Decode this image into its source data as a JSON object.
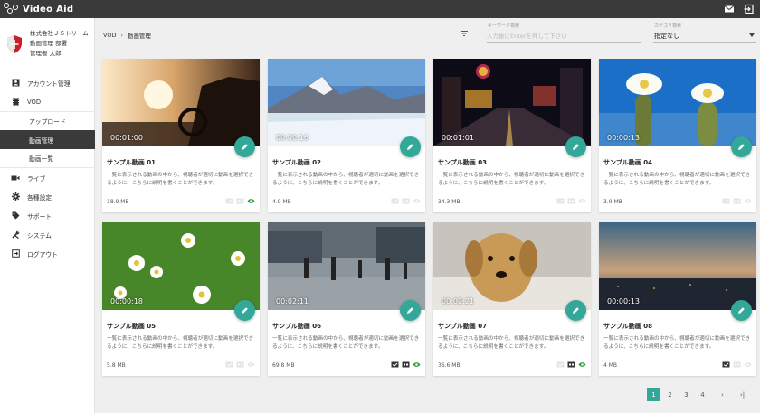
{
  "app": {
    "title": "Video Aid"
  },
  "org": {
    "company": "株式会社ＪＳトリーム",
    "department": "動画管理 部署",
    "user": "管理者 太郎"
  },
  "nav": {
    "items": [
      {
        "label": "アカウント管理",
        "icon": "user-card-icon"
      },
      {
        "label": "VOD",
        "icon": "film-icon"
      }
    ],
    "vod_sub": [
      {
        "label": "アップロード"
      },
      {
        "label": "動画管理"
      },
      {
        "label": "動画一覧"
      }
    ],
    "rest": [
      {
        "label": "ライブ",
        "icon": "video-camera-icon"
      },
      {
        "label": "各種設定",
        "icon": "gear-icon"
      },
      {
        "label": "サポート",
        "icon": "tag-icon"
      },
      {
        "label": "システム",
        "icon": "tools-icon"
      },
      {
        "label": "ログアウト",
        "icon": "logout-icon"
      }
    ]
  },
  "breadcrumb": {
    "root": "VOD",
    "current": "動画管理"
  },
  "search": {
    "label": "キーワード検索",
    "placeholder": "入力後にEnterを押して下さい",
    "value": ""
  },
  "category": {
    "label": "カテゴリ検索",
    "value": "指定なし"
  },
  "videos": [
    {
      "title": "サンプル動画 01",
      "duration": "00:01:00",
      "size": "18.9 MB",
      "desc": "一覧に表示される動画の中から、視聴者が適切に動画を選択できるように、こちらに説明を書くことができます。",
      "status": [
        "check-off",
        "cc-off",
        "eye-on"
      ]
    },
    {
      "title": "サンプル動画 02",
      "duration": "00:00:16",
      "size": "4.9 MB",
      "desc": "一覧に表示される動画の中から、視聴者が適切に動画を選択できるように、こちらに説明を書くことができます。",
      "status": [
        "check-off",
        "cc-off",
        "eye-off"
      ]
    },
    {
      "title": "サンプル動画 03",
      "duration": "00:01:01",
      "size": "34.3 MB",
      "desc": "一覧に表示される動画の中から、視聴者が適切に動画を選択できるように、こちらに説明を書くことができます。",
      "status": [
        "check-off",
        "cc-off",
        "eye-off"
      ]
    },
    {
      "title": "サンプル動画 04",
      "duration": "00:00:13",
      "size": "3.9 MB",
      "desc": "一覧に表示される動画の中から、視聴者が適切に動画を選択できるように、こちらに説明を書くことができます。",
      "status": [
        "check-off",
        "cc-off",
        "eye-off"
      ]
    },
    {
      "title": "サンプル動画 05",
      "duration": "00:00:18",
      "size": "5.8 MB",
      "desc": "一覧に表示される動画の中から、視聴者が適切に動画を選択できるように、こちらに説明を書くことができます。",
      "status": [
        "check-off",
        "cc-off",
        "eye-off"
      ]
    },
    {
      "title": "サンプル動画 06",
      "duration": "00:02:11",
      "size": "69.8 MB",
      "desc": "一覧に表示される動画の中から、視聴者が適切に動画を選択できるように、こちらに説明を書くことができます。",
      "status": [
        "check-on",
        "cc-on",
        "eye-on"
      ]
    },
    {
      "title": "サンプル動画 07",
      "duration": "00:02:21",
      "size": "36.6 MB",
      "desc": "一覧に表示される動画の中から、視聴者が適切に動画を選択できるように、こちらに説明を書くことができます。",
      "status": [
        "check-off",
        "cc-on",
        "eye-on"
      ]
    },
    {
      "title": "サンプル動画 08",
      "duration": "00:00:13",
      "size": "4 MB",
      "desc": "一覧に表示される動画の中から、視聴者が適切に動画を選択できるように、こちらに説明を書くことができます。",
      "status": [
        "check-on",
        "cc-off",
        "eye-off"
      ]
    }
  ],
  "pagination": {
    "pages": [
      "1",
      "2",
      "3",
      "4"
    ],
    "current": "1",
    "next": "›",
    "last": "›|"
  },
  "colors": {
    "accent": "#33a899",
    "topbar": "#3a3a3a",
    "eye_on": "#2e9e3c",
    "shield": "#c8202a"
  }
}
